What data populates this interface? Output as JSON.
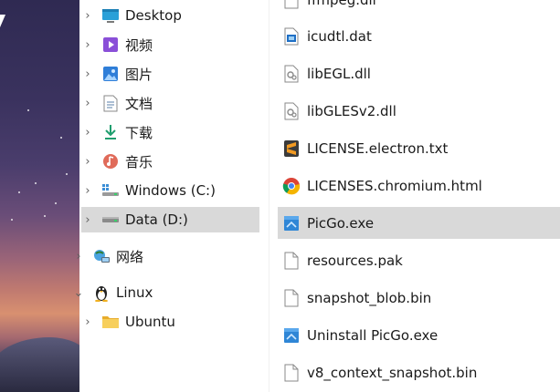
{
  "nav": {
    "items": [
      {
        "label": "Desktop",
        "icon": "desktop-icon"
      },
      {
        "label": "视频",
        "icon": "videos-icon"
      },
      {
        "label": "图片",
        "icon": "pictures-icon"
      },
      {
        "label": "文档",
        "icon": "documents-icon"
      },
      {
        "label": "下载",
        "icon": "downloads-icon"
      },
      {
        "label": "音乐",
        "icon": "music-icon"
      },
      {
        "label": "Windows (C:)",
        "icon": "drive-icon"
      },
      {
        "label": "Data (D:)",
        "icon": "drive-icon",
        "selected": true
      },
      {
        "label": "网络",
        "icon": "network-icon"
      },
      {
        "label": "Linux",
        "icon": "linux-icon",
        "expanded": true
      },
      {
        "label": "Ubuntu",
        "icon": "folder-icon"
      }
    ]
  },
  "files": {
    "items": [
      {
        "name": "icudtl.dat",
        "icon": "dat-file-icon"
      },
      {
        "name": "libEGL.dll",
        "icon": "dll-file-icon"
      },
      {
        "name": "libGLESv2.dll",
        "icon": "dll-file-icon"
      },
      {
        "name": "LICENSE.electron.txt",
        "icon": "sublime-text-icon"
      },
      {
        "name": "LICENSES.chromium.html",
        "icon": "chrome-icon"
      },
      {
        "name": "PicGo.exe",
        "icon": "exe-file-icon",
        "selected": true
      },
      {
        "name": "resources.pak",
        "icon": "generic-file-icon"
      },
      {
        "name": "snapshot_blob.bin",
        "icon": "generic-file-icon"
      },
      {
        "name": "Uninstall PicGo.exe",
        "icon": "exe-file-icon"
      },
      {
        "name": "v8_context_snapshot.bin",
        "icon": "generic-file-icon"
      }
    ]
  },
  "colors": {
    "selection": "#d9d9d9",
    "desktop_folder": "#2aa0d8",
    "videos_folder": "#8a4fd8",
    "pictures_folder": "#2f7ed8",
    "downloads_arrow": "#1f9e6e",
    "music": "#e06b5a",
    "ubuntu_folder": "#f2c14e"
  }
}
